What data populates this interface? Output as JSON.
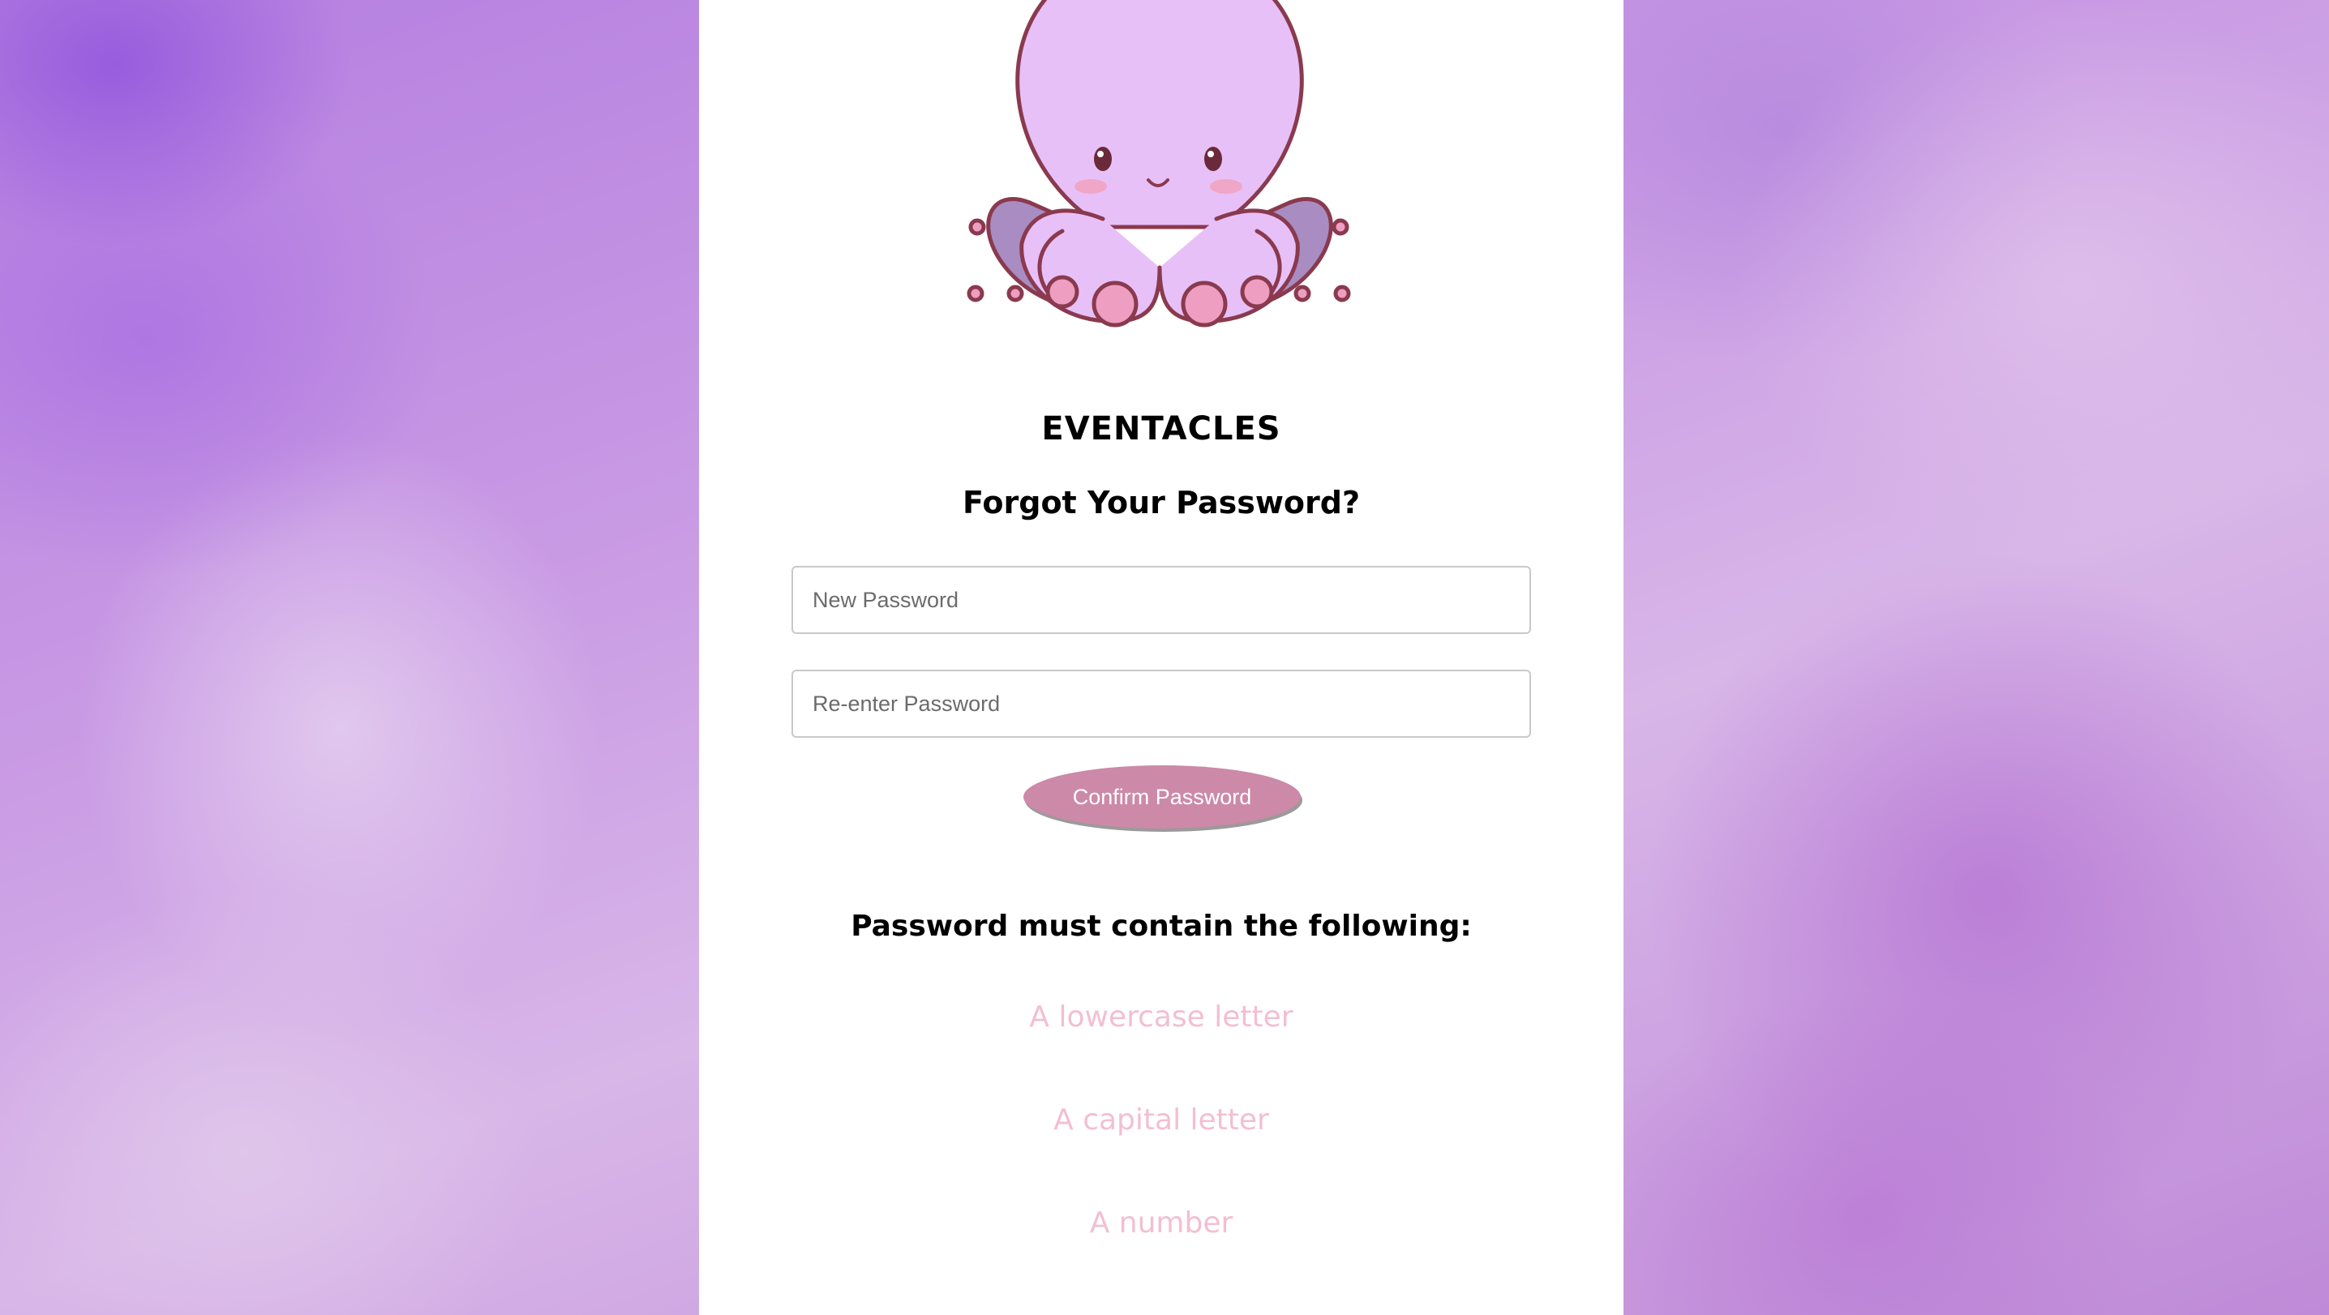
{
  "brand": {
    "name": "EVENTACLES",
    "mascot_icon": "octopus-mascot-icon"
  },
  "form": {
    "heading": "Forgot Your Password?",
    "new_password_placeholder": "New Password",
    "reenter_password_placeholder": "Re-enter Password",
    "confirm_label": "Confirm Password"
  },
  "requirements": {
    "title": "Password must contain the following:",
    "items": [
      {
        "label": "A lowercase letter"
      },
      {
        "label": "A capital letter"
      },
      {
        "label": "A number"
      }
    ]
  },
  "colors": {
    "panel_background": "#ffffff",
    "button": "#cc89a8",
    "requirement_text": "#f3bfd0",
    "mascot_body": "#e8c0f8",
    "mascot_outline": "#8a3a4e"
  }
}
